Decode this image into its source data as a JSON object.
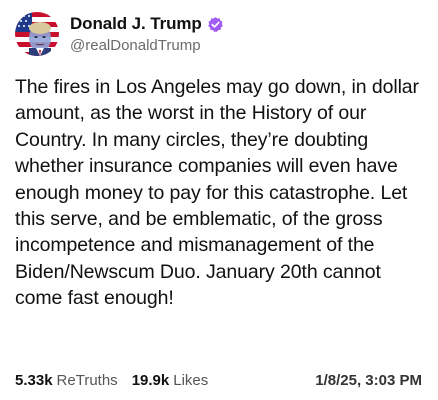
{
  "post": {
    "author": {
      "display_name": "Donald J. Trump",
      "handle": "@realDonaldTrump",
      "verified": true,
      "verified_color": "#a05cf2"
    },
    "text": "The fires in Los Angeles may go down, in dollar amount, as the worst in the History of our Country. In many circles, they’re doubting whether insurance companies will even have enough money to pay for this catastrophe. Let this serve, and be emblematic, of the gross incompetence and mismanagement of the Biden/Newscum Duo. January 20th cannot come fast enough!",
    "stats": {
      "retruths_count": "5.33k",
      "retruths_label": "ReTruths",
      "likes_count": "19.9k",
      "likes_label": "Likes"
    },
    "timestamp": "1/8/25, 3:03 PM"
  }
}
